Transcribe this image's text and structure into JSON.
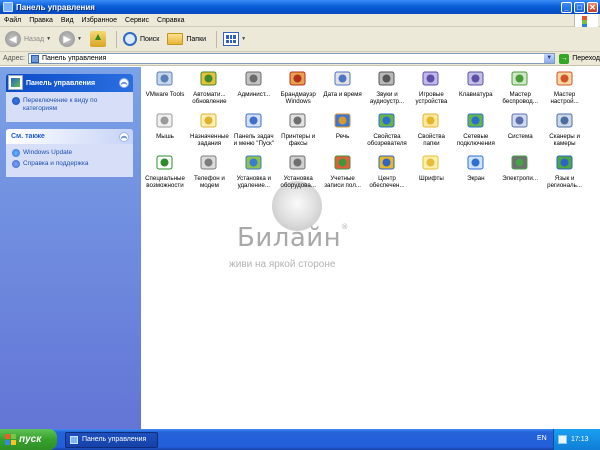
{
  "window": {
    "title": "Панель управления"
  },
  "menu": [
    "Файл",
    "Правка",
    "Вид",
    "Избранное",
    "Сервис",
    "Справка"
  ],
  "toolbar": {
    "back_label": "Назад",
    "search_label": "Поиск",
    "folders_label": "Папки"
  },
  "address": {
    "label": "Адрес:",
    "value": "Панель управления",
    "go_label": "Переход"
  },
  "left": {
    "main_panel": {
      "title": "Панель управления",
      "links": [
        "Переключение к виду по категориям"
      ]
    },
    "see_also": {
      "title": "См. также",
      "links": [
        "Windows Update",
        "Справка и поддержка"
      ]
    }
  },
  "icons": [
    {
      "label": "VMware Tools",
      "icon": "vmware-tools-icon"
    },
    {
      "label": "Автомати...\nобновление",
      "icon": "automatic-updates-icon"
    },
    {
      "label": "Админист...",
      "icon": "administrative-tools-icon"
    },
    {
      "label": "Брандмауэр\nWindows",
      "icon": "firewall-icon"
    },
    {
      "label": "Дата и время",
      "icon": "date-time-icon"
    },
    {
      "label": "Звуки и\nаудиоустр...",
      "icon": "sounds-icon"
    },
    {
      "label": "Игровые\nустройства",
      "icon": "game-controllers-icon"
    },
    {
      "label": "Клавиатура",
      "icon": "keyboard-icon"
    },
    {
      "label": "Мастер\nбеспровод...",
      "icon": "wireless-wizard-icon"
    },
    {
      "label": "Мастер\nнастрой...",
      "icon": "network-setup-wizard-icon"
    },
    {
      "label": "Мышь",
      "icon": "mouse-icon"
    },
    {
      "label": "Назначенные\nзадания",
      "icon": "scheduled-tasks-icon"
    },
    {
      "label": "Панель задач\nи меню \"Пуск\"",
      "icon": "taskbar-start-menu-icon"
    },
    {
      "label": "Принтеры и\nфаксы",
      "icon": "printers-faxes-icon"
    },
    {
      "label": "Речь",
      "icon": "speech-icon"
    },
    {
      "label": "Свойства\nобозревателя",
      "icon": "internet-options-icon"
    },
    {
      "label": "Свойства\nпапки",
      "icon": "folder-options-icon"
    },
    {
      "label": "Сетевые\nподключения",
      "icon": "network-connections-icon"
    },
    {
      "label": "Система",
      "icon": "system-icon"
    },
    {
      "label": "Сканеры и\nкамеры",
      "icon": "scanners-cameras-icon"
    },
    {
      "label": "Специальные\nвозможности",
      "icon": "accessibility-icon"
    },
    {
      "label": "Телефон и\nмодем",
      "icon": "phone-modem-icon"
    },
    {
      "label": "Установка и\nудаление...",
      "icon": "add-remove-programs-icon"
    },
    {
      "label": "Установка\nоборудова...",
      "icon": "add-hardware-icon"
    },
    {
      "label": "Учетные\nзаписи пол...",
      "icon": "user-accounts-icon"
    },
    {
      "label": "Центр\nобеспечен...",
      "icon": "security-center-icon"
    },
    {
      "label": "Шрифты",
      "icon": "fonts-icon"
    },
    {
      "label": "Экран",
      "icon": "display-icon"
    },
    {
      "label": "Электропи...",
      "icon": "power-options-icon"
    },
    {
      "label": "Язык и\nрегиональ...",
      "icon": "regional-language-icon"
    }
  ],
  "watermark": {
    "brand": "Билайн",
    "reg": "®",
    "tagline": "живи на яркой стороне"
  },
  "taskbar": {
    "start_label": "пуск",
    "task_label": "Панель управления",
    "lang": "EN",
    "clock": "17:13"
  },
  "colors": {
    "titlebar": "#0a5fd8",
    "taskbar": "#245edb",
    "start": "#36a12c",
    "leftpane": "#6375d6"
  }
}
